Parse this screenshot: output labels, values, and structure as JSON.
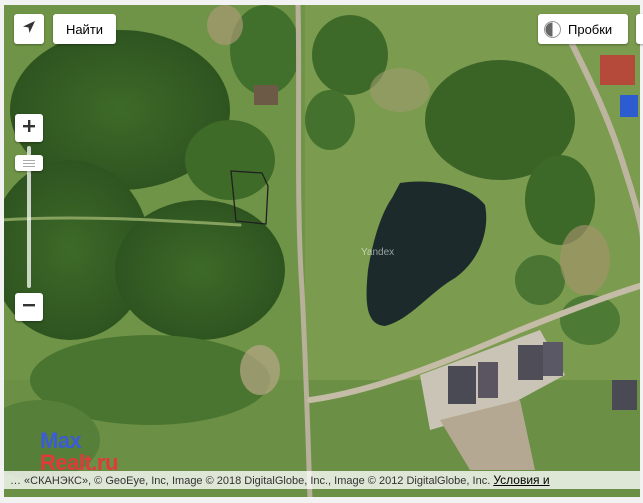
{
  "controls": {
    "locate_icon": "arrow-locate-icon",
    "search_label": "Найти",
    "traffic_label": "Пробки",
    "zoom_in_label": "+",
    "zoom_out_label": "−"
  },
  "map": {
    "watermark": "Yandex",
    "water_color": "#1c2a2c",
    "vegetation_color": "#4f7a32",
    "road_color": "#b8b09a"
  },
  "brand": {
    "line1": "Max",
    "line2": "Realt.ru"
  },
  "copyright": {
    "text": "… «СКАНЭКС», © GeoEye, Inc, Image © 2018 DigitalGlobe, Inc., Image © 2012 DigitalGlobe, Inc. ",
    "terms_label": "Условия и"
  }
}
